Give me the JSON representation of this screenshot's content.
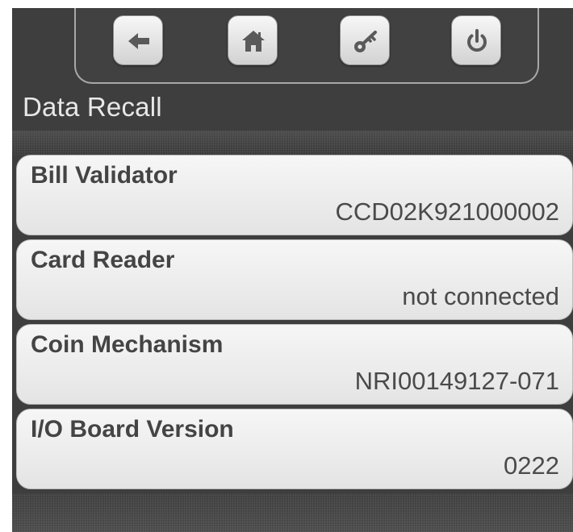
{
  "toolbar": {
    "buttons": [
      {
        "icon": "back-arrow-icon"
      },
      {
        "icon": "home-icon"
      },
      {
        "icon": "key-icon"
      },
      {
        "icon": "power-icon"
      }
    ]
  },
  "screen": {
    "title": "Data Recall"
  },
  "records": [
    {
      "label": "Bill Validator",
      "value": "CCD02K921000002"
    },
    {
      "label": "Card Reader",
      "value": "not connected"
    },
    {
      "label": "Coin Mechanism",
      "value": "NRI00149127-071"
    },
    {
      "label": "I/O Board Version",
      "value": "0222"
    }
  ],
  "colors": {
    "background": "#3e3e3e",
    "panel": "#efefef",
    "title_text": "#e8e8e8",
    "record_text": "#444444"
  }
}
